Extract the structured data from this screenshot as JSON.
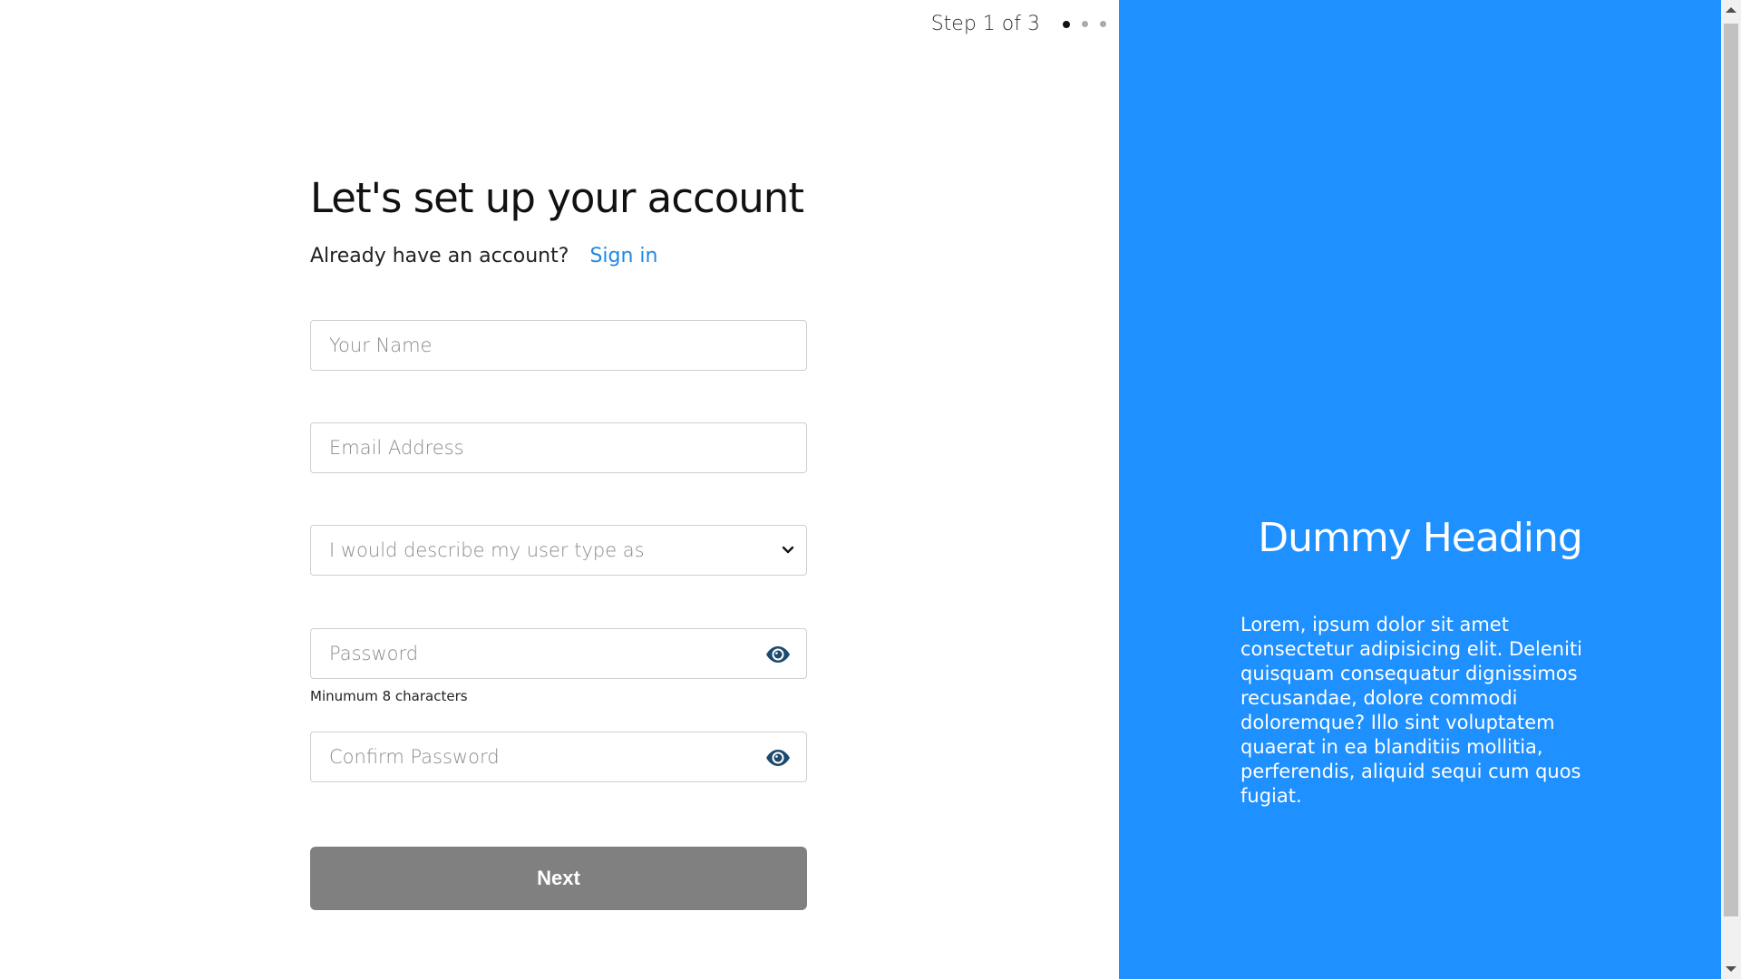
{
  "stepper": {
    "label": "Step 1 of 3",
    "total_steps": 3,
    "current_step": 1
  },
  "form": {
    "title": "Let's set up your account",
    "signin_prompt": "Already have an account?",
    "signin_link": "Sign in",
    "name_placeholder": "Your Name",
    "email_placeholder": "Email Address",
    "user_type_placeholder": "I would describe my user type as",
    "password_placeholder": "Password",
    "password_hint": "Minumum 8 characters",
    "confirm_password_placeholder": "Confirm Password",
    "next_label": "Next"
  },
  "panel": {
    "heading": "Dummy Heading",
    "body": "Lorem, ipsum dolor sit amet consectetur adipisicing elit. Deleniti quisquam consequatur dignissimos recusandae, dolore commodi doloremque? Illo sint voluptatem quaerat in ea blanditiis mollitia, perferendis, aliquid sequi cum quos fugiat."
  },
  "colors": {
    "accent": "#1e90ff",
    "link": "#1e88e5",
    "button_disabled": "#808080"
  },
  "icons": {
    "password_toggle": "eye-icon",
    "select_chevron": "chevron-down-icon"
  }
}
